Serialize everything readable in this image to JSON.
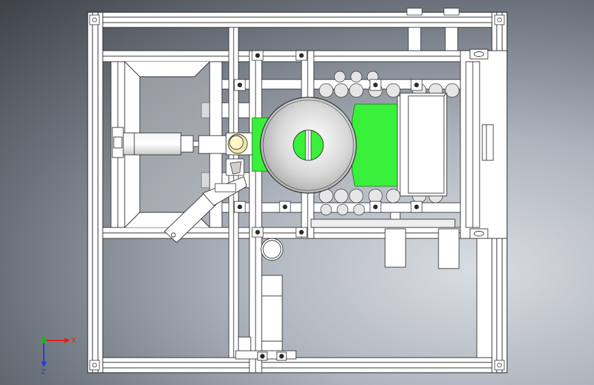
{
  "viewport": {
    "colors": {
      "frame_stroke": "#2b2b2b",
      "frame_fill": "#ffffff",
      "accent_green": "#39f03a",
      "lens_yellow": "#f3e7a0",
      "triad_x": "#e0201c",
      "triad_y": "#1bb51b",
      "triad_z": "#1c3fe0"
    }
  },
  "triad": {
    "x_label": "X",
    "z_label": "Z"
  }
}
